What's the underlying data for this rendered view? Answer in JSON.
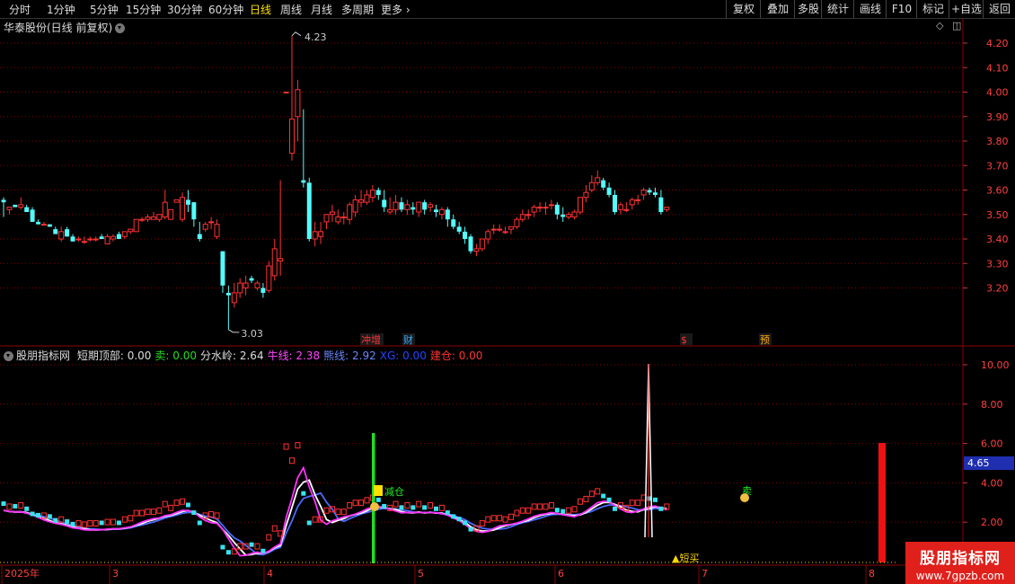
{
  "toolbar": {
    "periods": [
      "分时",
      "1分钟",
      "5分钟",
      "15分钟",
      "30分钟",
      "60分钟",
      "日线",
      "周线",
      "月线",
      "多周期",
      "更多"
    ],
    "active_period": "日线",
    "right_buttons": [
      "复权",
      "叠加",
      "多股",
      "统计",
      "画线",
      "F10",
      "标记",
      "+自选",
      "返回"
    ]
  },
  "stock": {
    "title": "华泰股份(日线 前复权)"
  },
  "indicator": {
    "name": "股朋指标网",
    "items": [
      {
        "label": "短期顶部: 0.00",
        "color": "#dddddd"
      },
      {
        "label": "卖: 0.00",
        "color": "#22dd22"
      },
      {
        "label": "分水岭: 2.64",
        "color": "#dddddd"
      },
      {
        "label": "牛线: 2.38",
        "color": "#ff44ff"
      },
      {
        "label": "熊线: 2.92",
        "color": "#6a86ff"
      },
      {
        "label": "XG: 0.00",
        "color": "#2244ff"
      },
      {
        "label": "建仓: 0.00",
        "color": "#ff3333"
      }
    ]
  },
  "price_axis": [
    "4.20",
    "4.10",
    "4.00",
    "3.90",
    "3.80",
    "3.70",
    "3.60",
    "3.50",
    "3.40",
    "3.30",
    "3.20"
  ],
  "ind_axis": [
    "10.00",
    "8.00",
    "6.00",
    "4.00",
    "2.00"
  ],
  "ind_current": "4.65",
  "annotations": {
    "high": "4.23",
    "low": "3.03",
    "reduce": "减仓",
    "short_buy": "短买",
    "sell": "卖"
  },
  "event_tags": [
    {
      "text": "冲增",
      "color": "#ff3333"
    },
    {
      "text": "财",
      "color": "#33aaff"
    },
    {
      "text": "$",
      "color": "#ff3333"
    },
    {
      "text": "预",
      "color": "#ffaa00"
    }
  ],
  "time_axis": [
    "2025年",
    "3",
    "4",
    "5",
    "6",
    "7",
    "8"
  ],
  "watermark": {
    "title": "股朋指标网",
    "url": "www.7gpzb.com"
  },
  "colors": {
    "up": "#ff3232",
    "down": "#54fcfc",
    "bg": "#000000",
    "grid": "#8b0000"
  },
  "chart_data": {
    "type": "candlestick",
    "y_range": [
      3.0,
      4.25
    ],
    "candles": [
      [
        3.56,
        3.57,
        3.55,
        3.49
      ],
      [
        3.52,
        3.53,
        3.53,
        3.5
      ],
      [
        3.54,
        3.54,
        3.53,
        3.54
      ],
      [
        3.53,
        3.57,
        3.54,
        3.52
      ],
      [
        3.53,
        3.54,
        3.51,
        3.52
      ],
      [
        3.52,
        3.53,
        3.47,
        3.47
      ],
      [
        3.47,
        3.48,
        3.46,
        3.46
      ],
      [
        3.46,
        3.47,
        3.46,
        3.46
      ],
      [
        3.46,
        3.46,
        3.45,
        3.45
      ],
      [
        3.44,
        3.45,
        3.42,
        3.42
      ],
      [
        3.4,
        3.45,
        3.43,
        3.39
      ],
      [
        3.44,
        3.45,
        3.41,
        3.41
      ],
      [
        3.41,
        3.42,
        3.39,
        3.39
      ],
      [
        3.4,
        3.41,
        3.4,
        3.39
      ],
      [
        3.39,
        3.41,
        3.39,
        3.38
      ],
      [
        3.4,
        3.41,
        3.4,
        3.39
      ],
      [
        3.4,
        3.41,
        3.4,
        3.39
      ],
      [
        3.41,
        3.42,
        3.4,
        3.4
      ],
      [
        3.38,
        3.42,
        3.41,
        3.38
      ],
      [
        3.4,
        3.42,
        3.41,
        3.39
      ],
      [
        3.42,
        3.43,
        3.4,
        3.4
      ],
      [
        3.41,
        3.43,
        3.43,
        3.4
      ],
      [
        3.43,
        3.44,
        3.44,
        3.42
      ],
      [
        3.43,
        3.48,
        3.48,
        3.43
      ],
      [
        3.48,
        3.49,
        3.48,
        3.47
      ],
      [
        3.48,
        3.5,
        3.49,
        3.47
      ],
      [
        3.48,
        3.51,
        3.49,
        3.48
      ],
      [
        3.48,
        3.49,
        3.5,
        3.47
      ],
      [
        3.49,
        3.6,
        3.55,
        3.48
      ],
      [
        3.48,
        3.52,
        3.52,
        3.48
      ],
      [
        3.55,
        3.55,
        3.56,
        3.55
      ],
      [
        3.48,
        3.59,
        3.57,
        3.47
      ],
      [
        3.56,
        3.6,
        3.54,
        3.51
      ],
      [
        3.55,
        3.55,
        3.48,
        3.45
      ],
      [
        3.42,
        3.47,
        3.4,
        3.39
      ],
      [
        3.44,
        3.47,
        3.46,
        3.43
      ],
      [
        3.47,
        3.49,
        3.47,
        3.44
      ],
      [
        3.41,
        3.48,
        3.46,
        3.4
      ],
      [
        3.35,
        3.35,
        3.21,
        3.18
      ],
      [
        3.18,
        3.21,
        3.17,
        3.03
      ],
      [
        3.14,
        3.22,
        3.18,
        3.12
      ],
      [
        3.18,
        3.24,
        3.22,
        3.16
      ],
      [
        3.2,
        3.25,
        3.22,
        3.17
      ],
      [
        3.24,
        3.25,
        3.23,
        3.22
      ],
      [
        3.2,
        3.23,
        3.22,
        3.19
      ],
      [
        3.2,
        3.22,
        3.18,
        3.16
      ],
      [
        3.19,
        3.31,
        3.29,
        3.18
      ],
      [
        3.25,
        3.4,
        3.36,
        3.23
      ],
      [
        3.31,
        3.64,
        3.32,
        3.25
      ],
      [
        4.0,
        4.0,
        4.0,
        4.0
      ],
      [
        3.75,
        4.23,
        3.89,
        3.72
      ],
      [
        3.9,
        4.05,
        4.01,
        3.8
      ],
      [
        3.64,
        3.93,
        3.63,
        3.61
      ],
      [
        3.63,
        3.65,
        3.4,
        3.39
      ],
      [
        3.4,
        3.47,
        3.43,
        3.37
      ],
      [
        3.41,
        3.47,
        3.43,
        3.38
      ],
      [
        3.47,
        3.49,
        3.5,
        3.44
      ],
      [
        3.5,
        3.54,
        3.51,
        3.47
      ],
      [
        3.47,
        3.52,
        3.49,
        3.46
      ],
      [
        3.49,
        3.51,
        3.49,
        3.46
      ],
      [
        3.48,
        3.55,
        3.54,
        3.46
      ],
      [
        3.51,
        3.58,
        3.56,
        3.49
      ],
      [
        3.55,
        3.6,
        3.56,
        3.53
      ],
      [
        3.55,
        3.6,
        3.58,
        3.54
      ],
      [
        3.57,
        3.62,
        3.6,
        3.55
      ],
      [
        3.6,
        3.61,
        3.58,
        3.56
      ],
      [
        3.56,
        3.6,
        3.53,
        3.51
      ],
      [
        3.51,
        3.57,
        3.52,
        3.5
      ],
      [
        3.52,
        3.58,
        3.55,
        3.5
      ],
      [
        3.55,
        3.57,
        3.52,
        3.51
      ],
      [
        3.52,
        3.56,
        3.54,
        3.5
      ],
      [
        3.53,
        3.55,
        3.52,
        3.5
      ],
      [
        3.51,
        3.55,
        3.55,
        3.49
      ],
      [
        3.55,
        3.56,
        3.52,
        3.5
      ],
      [
        3.53,
        3.55,
        3.54,
        3.51
      ],
      [
        3.52,
        3.54,
        3.51,
        3.49
      ],
      [
        3.5,
        3.53,
        3.52,
        3.48
      ],
      [
        3.52,
        3.53,
        3.48,
        3.45
      ],
      [
        3.48,
        3.5,
        3.45,
        3.44
      ],
      [
        3.45,
        3.47,
        3.43,
        3.42
      ],
      [
        3.43,
        3.45,
        3.4,
        3.38
      ],
      [
        3.41,
        3.42,
        3.35,
        3.34
      ],
      [
        3.35,
        3.38,
        3.36,
        3.33
      ],
      [
        3.36,
        3.4,
        3.4,
        3.35
      ],
      [
        3.4,
        3.44,
        3.43,
        3.38
      ],
      [
        3.44,
        3.46,
        3.44,
        3.42
      ],
      [
        3.44,
        3.46,
        3.44,
        3.43
      ],
      [
        3.43,
        3.45,
        3.43,
        3.42
      ],
      [
        3.44,
        3.45,
        3.45,
        3.42
      ],
      [
        3.45,
        3.49,
        3.48,
        3.44
      ],
      [
        3.48,
        3.52,
        3.5,
        3.47
      ],
      [
        3.5,
        3.52,
        3.5,
        3.48
      ],
      [
        3.51,
        3.54,
        3.53,
        3.49
      ],
      [
        3.53,
        3.55,
        3.53,
        3.51
      ],
      [
        3.53,
        3.55,
        3.53,
        3.5
      ],
      [
        3.54,
        3.56,
        3.54,
        3.52
      ],
      [
        3.54,
        3.55,
        3.5,
        3.48
      ],
      [
        3.5,
        3.53,
        3.49,
        3.47
      ],
      [
        3.49,
        3.51,
        3.5,
        3.48
      ],
      [
        3.49,
        3.52,
        3.51,
        3.48
      ],
      [
        3.51,
        3.56,
        3.57,
        3.5
      ],
      [
        3.57,
        3.62,
        3.59,
        3.55
      ],
      [
        3.6,
        3.66,
        3.63,
        3.59
      ],
      [
        3.63,
        3.68,
        3.65,
        3.62
      ],
      [
        3.64,
        3.65,
        3.61,
        3.6
      ],
      [
        3.61,
        3.63,
        3.58,
        3.57
      ],
      [
        3.58,
        3.6,
        3.51,
        3.5
      ],
      [
        3.52,
        3.55,
        3.54,
        3.5
      ],
      [
        3.52,
        3.55,
        3.52,
        3.51
      ],
      [
        3.54,
        3.57,
        3.56,
        3.52
      ],
      [
        3.56,
        3.58,
        3.56,
        3.54
      ],
      [
        3.58,
        3.61,
        3.6,
        3.56
      ],
      [
        3.6,
        3.61,
        3.59,
        3.58
      ],
      [
        3.59,
        3.61,
        3.58,
        3.57
      ],
      [
        3.57,
        3.6,
        3.51,
        3.5
      ],
      [
        3.52,
        3.53,
        3.53,
        3.51
      ]
    ]
  }
}
